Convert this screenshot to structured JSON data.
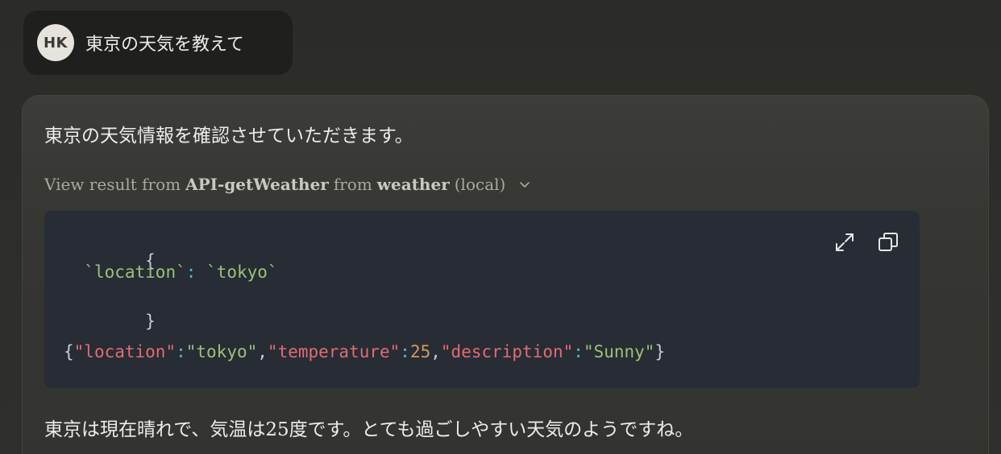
{
  "user_message": {
    "avatar_initials": "HK",
    "text": "東京の天気を教えて"
  },
  "assistant_message": {
    "intro": "東京の天気情報を確認させていただきます。",
    "tool_summary": {
      "prefix": "View result from",
      "tool_name": "API-getWeather",
      "middle": "from",
      "server_name": "weather",
      "suffix": "(local)",
      "chevron_icon": "chevron-down-icon"
    },
    "code": {
      "open_brace": "{",
      "arg_key": "`location`",
      "arg_colon": ":",
      "arg_value": "`tokyo`",
      "close_brace": "}",
      "result": {
        "open": "{",
        "k1": "\"location\"",
        "v1": "\"tokyo\"",
        "k2": "\"temperature\"",
        "v2": "25",
        "k3": "\"description\"",
        "v3": "\"Sunny\"",
        "close": "}",
        "colon": ":",
        "comma": ","
      },
      "expand_icon": "expand-icon",
      "copy_icon": "copy-icon"
    },
    "answer": "東京は現在晴れで、気温は25度です。とても過ごしやすい天気のようですね。"
  },
  "colors": {
    "background": "#2e2e2b",
    "code_bg": "#282c34",
    "string": "#98c379",
    "key": "#e06c75",
    "number": "#d19a66"
  }
}
